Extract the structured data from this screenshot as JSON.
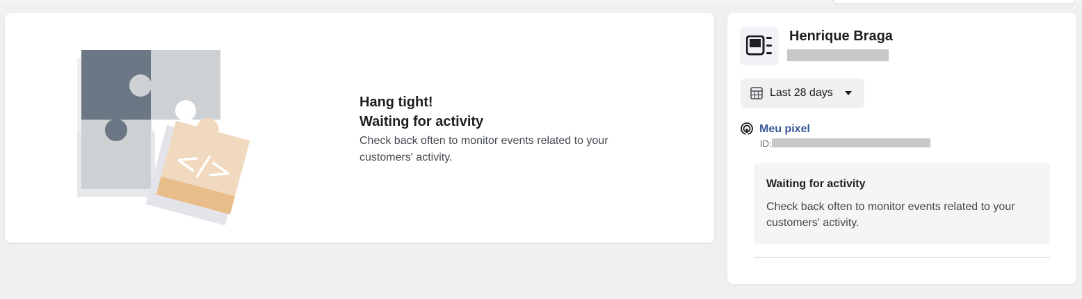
{
  "main_card": {
    "title_line1": "Hang tight!",
    "title_line2": "Waiting for activity",
    "body": "Check back often to monitor events related to your customers' activity."
  },
  "side_panel": {
    "account_icon": "ad-account-icon",
    "account_name": "Henrique Braga",
    "date_range_icon": "calendar-icon",
    "date_range_label": "Last 28 days",
    "date_range_caret": "caret-down-icon",
    "pixel_icon": "broadcast-pixel-icon",
    "pixel_name": "Meu pixel",
    "pixel_id_label": "ID:",
    "status_title": "Waiting for activity",
    "status_body": "Check back often to monitor events related to your customers' activity."
  },
  "colors": {
    "background": "#f0f0f0",
    "card": "#ffffff",
    "link": "#385898",
    "puzzle_dark": "#6b7784",
    "puzzle_light": "#cdd1d4",
    "puzzle_orange": "#f0d9bf",
    "redaction": "#c8c8c8"
  }
}
